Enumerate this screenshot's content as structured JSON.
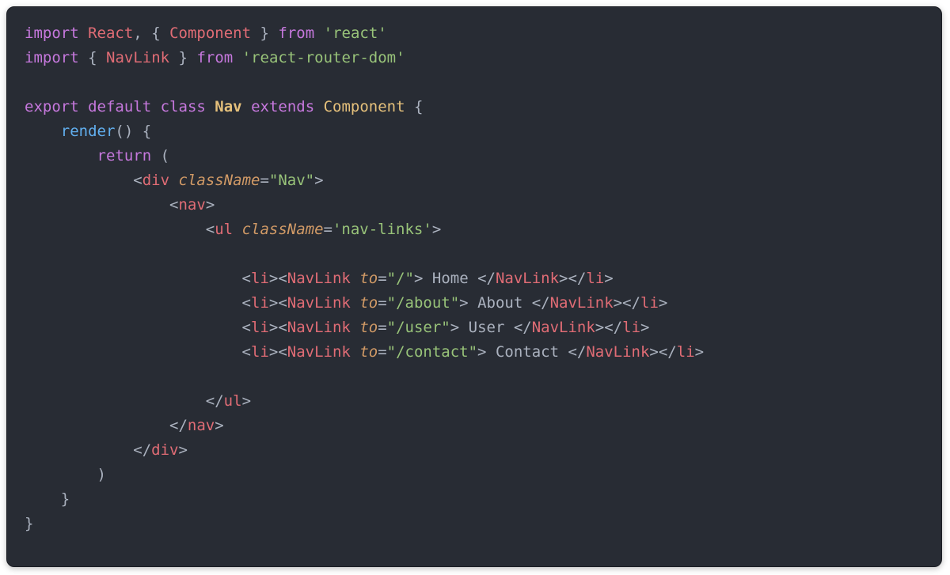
{
  "line1": {
    "import": "import",
    "React": "React",
    "comma": ",",
    "brace_open": "{",
    "Component": "Component",
    "brace_close": "}",
    "from": "from",
    "module": "'react'"
  },
  "line2": {
    "import": "import",
    "brace_open": "{",
    "NavLink": "NavLink",
    "brace_close": "}",
    "from": "from",
    "module": "'react-router-dom'"
  },
  "line4": {
    "export": "export",
    "default": "default",
    "class": "class",
    "Nav": "Nav",
    "extends": "extends",
    "Component": "Component",
    "brace": "{"
  },
  "line5": {
    "render": "render",
    "parens": "()",
    "brace": "{"
  },
  "line6": {
    "return": "return",
    "paren": "("
  },
  "line7": {
    "lt": "<",
    "div": "div",
    "sp": " ",
    "attr": "className",
    "eq": "=",
    "val": "\"Nav\"",
    "gt": ">"
  },
  "line8": {
    "lt": "<",
    "nav": "nav",
    "gt": ">"
  },
  "line9": {
    "lt": "<",
    "ul": "ul",
    "sp": " ",
    "attr": "className",
    "eq": "=",
    "val": "'nav-links'",
    "gt": ">"
  },
  "navlinks": [
    {
      "to": "\"/\"",
      "label": " Home "
    },
    {
      "to": "\"/about\"",
      "label": " About "
    },
    {
      "to": "\"/user\"",
      "label": " User "
    },
    {
      "to": "\"/contact\"",
      "label": " Contact "
    }
  ],
  "tags": {
    "li": "li",
    "NavLink": "NavLink",
    "to": "to",
    "ul_close": "ul",
    "nav_close": "nav",
    "div_close": "div"
  },
  "closing": {
    "paren": ")",
    "brace1": "}",
    "brace2": "}"
  }
}
